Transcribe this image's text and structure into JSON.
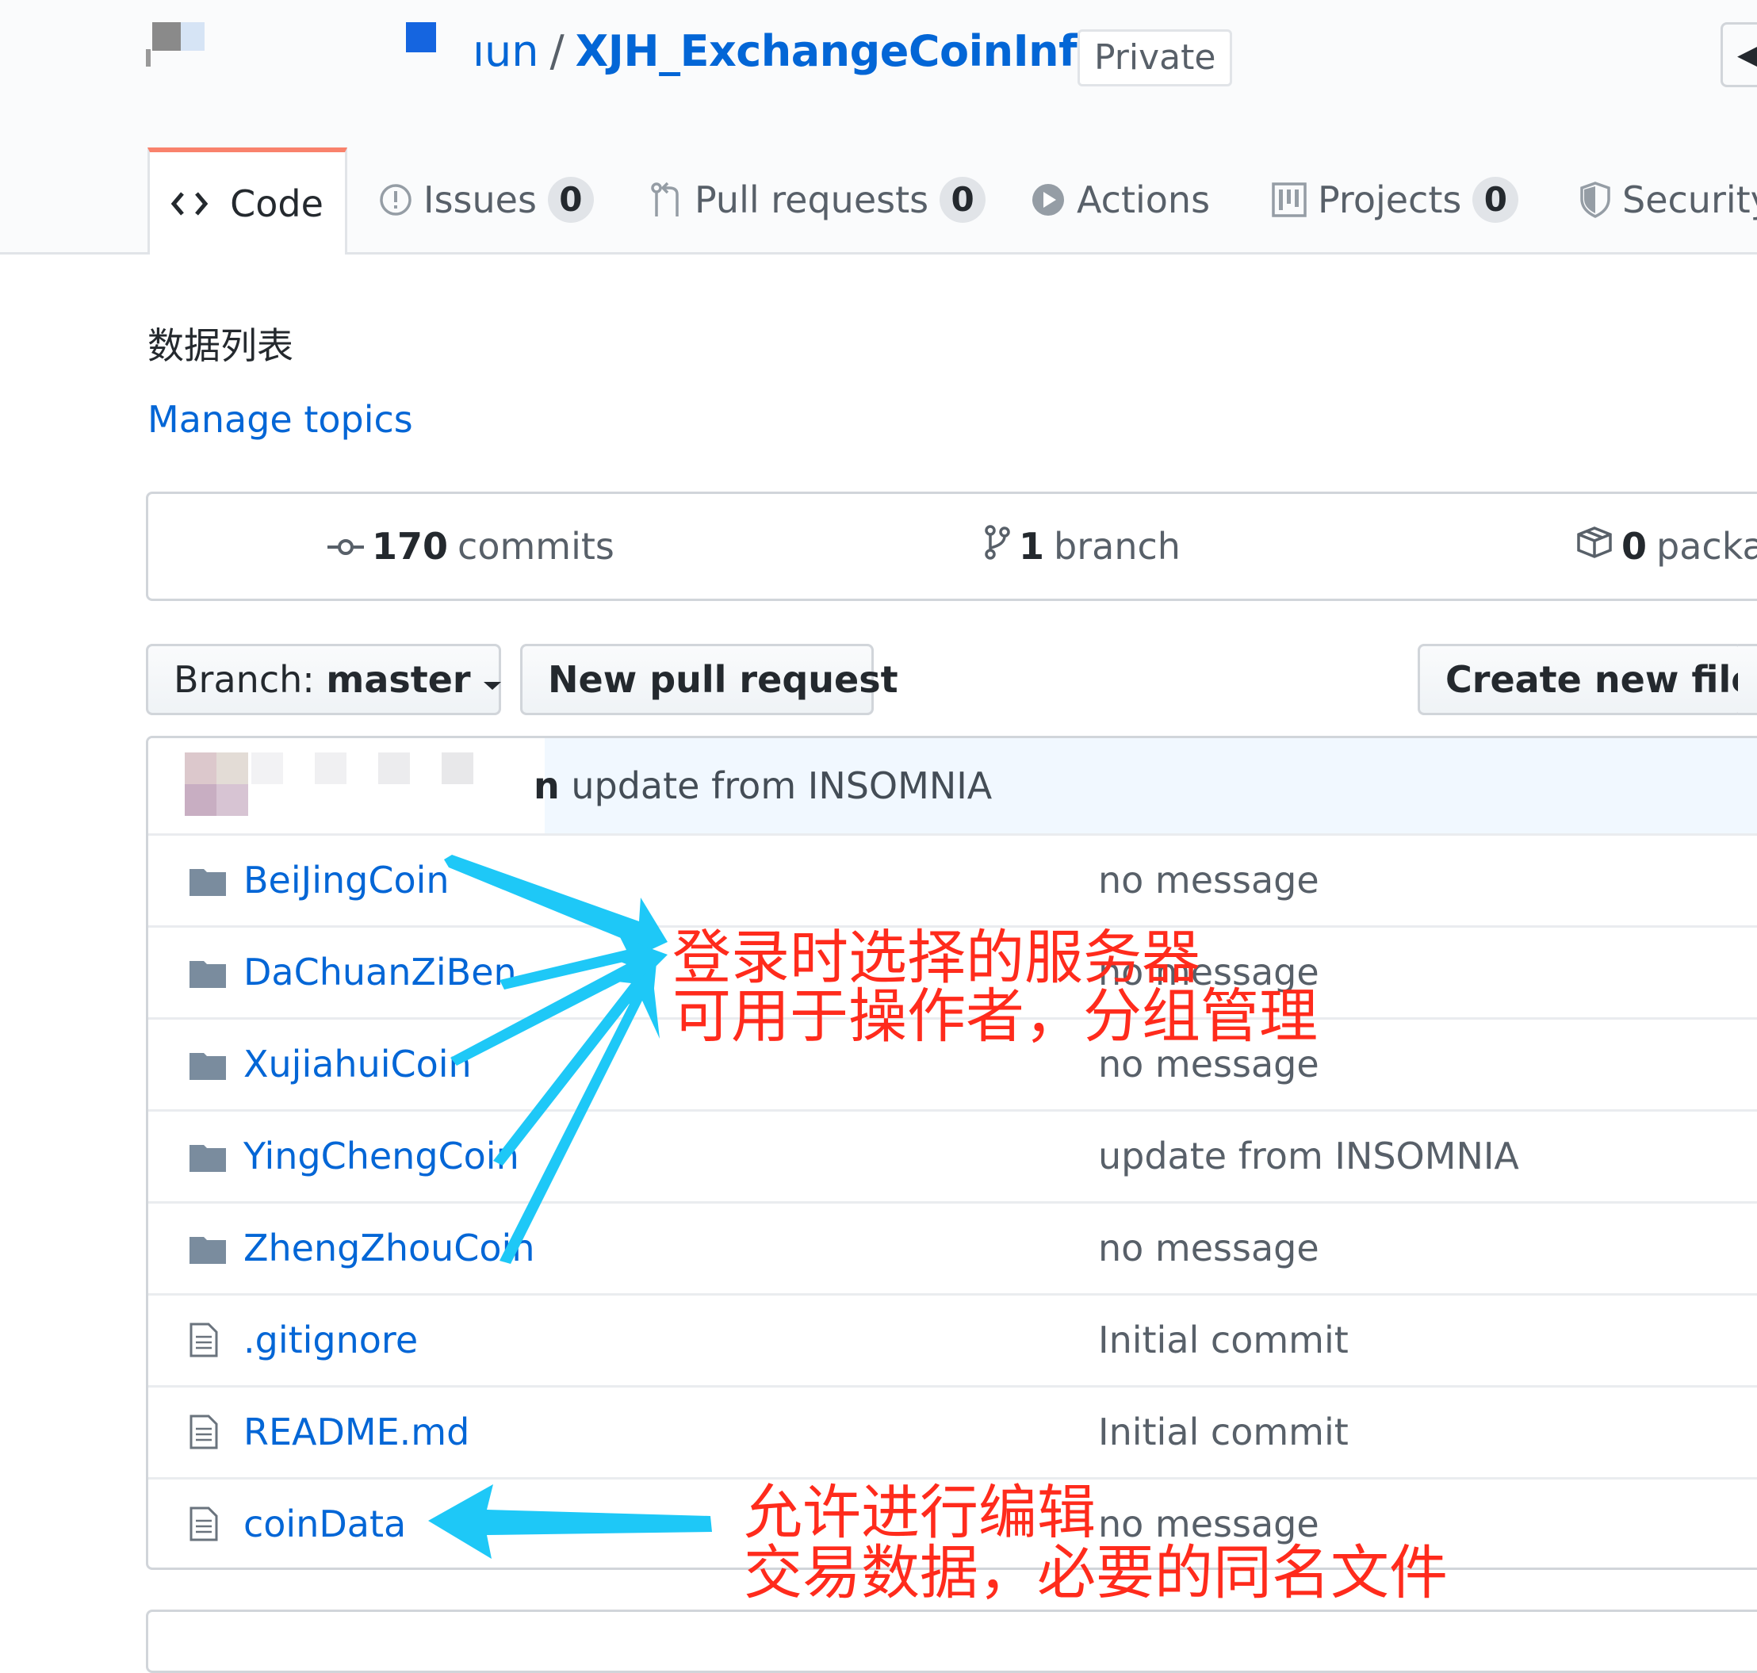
{
  "repo": {
    "owner_fragment": "ıun",
    "separator": "/",
    "name": "XJH_ExchangeCoinInfo",
    "visibility": "Private"
  },
  "tabs": [
    {
      "label": "Code",
      "icon": "code-icon",
      "selected": true
    },
    {
      "label": "Issues",
      "icon": "issue-opened-icon",
      "count": "0"
    },
    {
      "label": "Pull requests",
      "icon": "git-pull-request-icon",
      "count": "0"
    },
    {
      "label": "Actions",
      "icon": "play-icon"
    },
    {
      "label": "Projects",
      "icon": "project-icon",
      "count": "0"
    },
    {
      "label": "Security",
      "icon": "shield-icon"
    }
  ],
  "description": "数据列表",
  "manage_topics": "Manage topics",
  "summary": {
    "commits_count": "170",
    "commits_label": "commits",
    "branch_count": "1",
    "branch_label": "branch",
    "packages_count": "0",
    "packages_label": "packa"
  },
  "file_nav": {
    "branch_prefix": "Branch:",
    "branch_name": "master",
    "new_pr": "New pull request",
    "create_file": "Create new file"
  },
  "latest_commit": {
    "author_fragment": "n",
    "message": "update from INSOMNIA"
  },
  "files": [
    {
      "type": "folder",
      "name": "BeiJingCoin",
      "message": "no message"
    },
    {
      "type": "folder",
      "name": "DaChuanZiBen",
      "message": "no message"
    },
    {
      "type": "folder",
      "name": "XujiahuiCoin",
      "message": "no message"
    },
    {
      "type": "folder",
      "name": "YingChengCoin",
      "message": "update from INSOMNIA"
    },
    {
      "type": "folder",
      "name": "ZhengZhouCoin",
      "message": "no message"
    },
    {
      "type": "file",
      "name": ".gitignore",
      "message": "Initial commit"
    },
    {
      "type": "file",
      "name": "README.md",
      "message": "Initial commit"
    },
    {
      "type": "file",
      "name": "coinData",
      "message": "no message"
    }
  ],
  "annotations": {
    "servers_line1": "登录时选择的服务器",
    "servers_line2": "可用于操作者，分组管理",
    "coindata_line1": "允许进行编辑",
    "coindata_line2": "交易数据，必要的同名文件"
  },
  "colors": {
    "link": "#0366d6",
    "tab_accent": "#f9826c",
    "annotation_text": "#ff2b1c",
    "annotation_arrow": "#1ec8f7"
  }
}
